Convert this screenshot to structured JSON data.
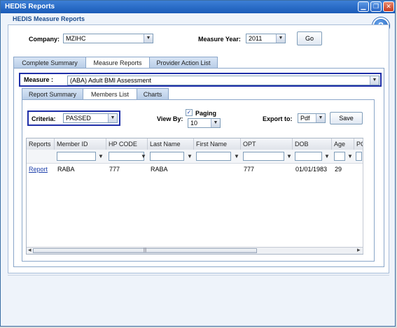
{
  "window": {
    "title": "HEDIS Reports",
    "minimize_glyph": "▁",
    "maximize_glyph": "❐",
    "close_glyph": "✕"
  },
  "section_title": "HEDIS Measure Reports",
  "help_icon_glyph": "?",
  "company": {
    "label": "Company:",
    "value": "MZIHC"
  },
  "measure_year": {
    "label": "Measure Year:",
    "value": "2011"
  },
  "go_label": "Go",
  "top_tabs": [
    "Complete Summary",
    "Measure Reports",
    "Provider Action List"
  ],
  "measure": {
    "label": "Measure :",
    "value": "(ABA) Adult BMI Assessment"
  },
  "sub_tabs": [
    "Report Summary",
    "Members List",
    "Charts"
  ],
  "criteria": {
    "label": "Criteria:",
    "value": "PASSED"
  },
  "view_by": {
    "label": "View By:",
    "paging_label": "Paging",
    "paging_checked": true,
    "page_size": "10"
  },
  "export": {
    "label": "Export to:",
    "value": "Pdf"
  },
  "save_label": "Save",
  "dropdown_arrow": "▼",
  "check_glyph": "✓",
  "filter_glyph": "▼",
  "grid": {
    "columns": [
      "Reports",
      "Member ID",
      "HP CODE",
      "Last Name",
      "First Name",
      "OPT",
      "DOB",
      "Age",
      "PC"
    ],
    "rows": [
      {
        "reports": "Report",
        "member_id": "RABA",
        "hp_code": "777",
        "last_name": "RABA",
        "first_name": "",
        "opt": "777",
        "dob": "01/01/1983",
        "age": "29",
        "pc": ""
      }
    ]
  },
  "scroll": {
    "left_arrow": "◂",
    "right_arrow": "▸",
    "grip": "|||"
  }
}
